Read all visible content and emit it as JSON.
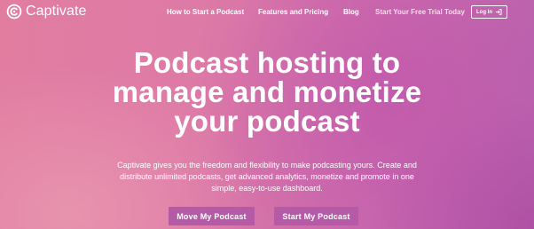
{
  "brand": {
    "name": "Captivate",
    "logo_icon": "captivate-logo-icon"
  },
  "nav": {
    "items": [
      {
        "label": "How to Start a Podcast"
      },
      {
        "label": "Features and Pricing"
      },
      {
        "label": "Blog"
      },
      {
        "label": "Start Your Free Trial Today"
      }
    ],
    "login_label": "Log In",
    "login_icon": "login-arrow-icon"
  },
  "hero": {
    "headline_lines": [
      "Podcast hosting to",
      "manage and monetize",
      "your podcast"
    ],
    "subtext_lines": [
      "Captivate gives you the freedom and flexibility to make podcasting yours. Create and",
      "distribute unlimited podcasts, get advanced analytics, monetize and promote in one",
      "simple, easy-to-use dashboard."
    ],
    "cta_primary": "Move My Podcast",
    "cta_secondary": "Start My Podcast"
  },
  "colors": {
    "background_start": "#e27da0",
    "background_end": "#b960ad",
    "button": "#b55aa6",
    "text": "#ffffff"
  }
}
